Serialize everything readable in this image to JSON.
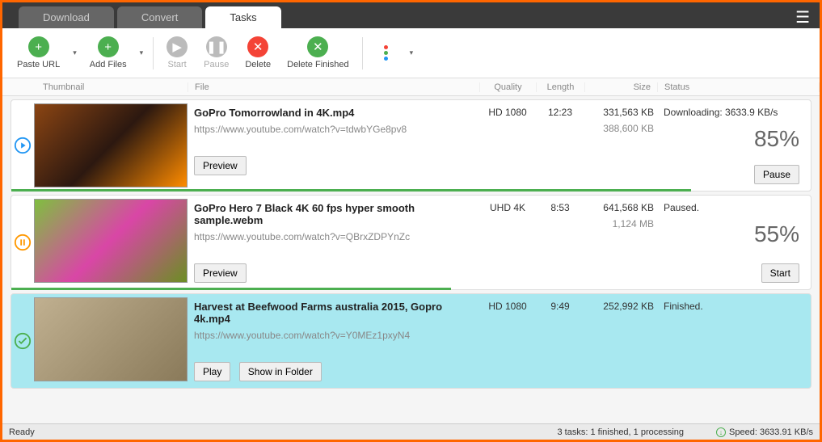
{
  "tabs": {
    "download": "Download",
    "convert": "Convert",
    "tasks": "Tasks"
  },
  "toolbar": {
    "paste_url": "Paste URL",
    "add_files": "Add Files",
    "start": "Start",
    "pause": "Pause",
    "delete": "Delete",
    "delete_finished": "Delete Finished"
  },
  "headers": {
    "thumbnail": "Thumbnail",
    "file": "File",
    "quality": "Quality",
    "length": "Length",
    "size": "Size",
    "status": "Status"
  },
  "tasks": [
    {
      "title": "GoPro  Tomorrowland in 4K.mp4",
      "url": "https://www.youtube.com/watch?v=tdwbYGe8pv8",
      "quality": "HD 1080",
      "length": "12:23",
      "size": "331,563 KB",
      "size_sub": "388,600 KB",
      "status": "Downloading: 3633.9 KB/s",
      "percent": "85%",
      "progress": 85,
      "btn1": "Preview",
      "action_btn": "Pause",
      "state": "playing"
    },
    {
      "title": "GoPro Hero 7 Black 4K 60 fps hyper smooth sample.webm",
      "url": "https://www.youtube.com/watch?v=QBrxZDPYnZc",
      "quality": "UHD 4K",
      "length": "8:53",
      "size": "641,568 KB",
      "size_sub": "1,124 MB",
      "status": "Paused.",
      "percent": "55%",
      "progress": 55,
      "btn1": "Preview",
      "action_btn": "Start",
      "state": "paused"
    },
    {
      "title": "Harvest at Beefwood Farms australia 2015, Gopro 4k.mp4",
      "url": "https://www.youtube.com/watch?v=Y0MEz1pxyN4",
      "quality": "HD 1080",
      "length": "9:49",
      "size": "252,992 KB",
      "size_sub": "",
      "status": "Finished.",
      "percent": "",
      "progress": 0,
      "btn1": "Play",
      "btn2": "Show in Folder",
      "action_btn": "",
      "state": "finished"
    }
  ],
  "statusbar": {
    "ready": "Ready",
    "summary": "3 tasks: 1 finished, 1 processing",
    "speed": "Speed: 3633.91 KB/s"
  }
}
